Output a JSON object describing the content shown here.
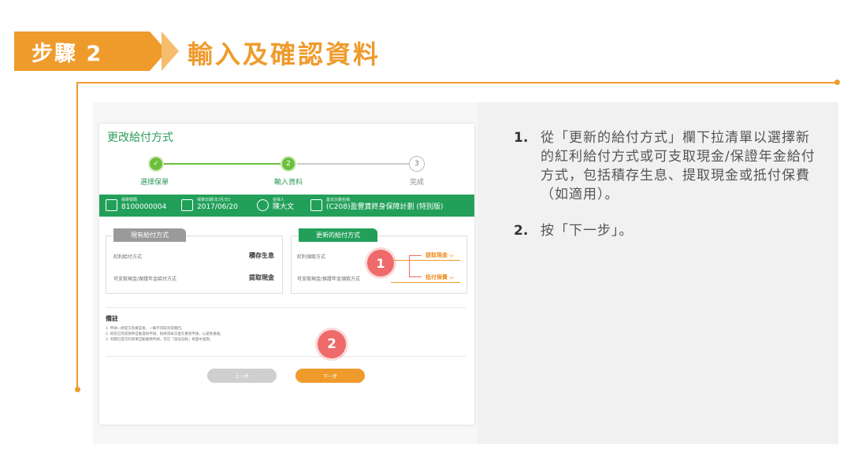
{
  "header": {
    "step_label": "步驟 2",
    "title": "輸入及確認資料"
  },
  "colors": {
    "accent": "#ef9b2c",
    "green": "#22a05a",
    "callout": "#ef6a6a"
  },
  "instructions": [
    {
      "num": "1.",
      "text": "從「更新的給付方式」欄下拉清單以選擇新的紅利給付方式或可支取現金/保證年金給付方式，包括積存生息、提取現金或抵付保費（如適用）。"
    },
    {
      "num": "2.",
      "text": "按「下一步」。"
    }
  ],
  "card": {
    "title": "更改給付方式",
    "steps": [
      {
        "num": "✓",
        "label": "選擇保單"
      },
      {
        "num": "2",
        "label": "輸入資料"
      },
      {
        "num": "3",
        "label": "完成"
      }
    ],
    "info_bar": [
      {
        "icon": "policy-icon",
        "small": "保單號碼",
        "value": "8100000004"
      },
      {
        "icon": "calendar-icon",
        "small": "保單日期(年/月/日)",
        "value": "2017/06/20"
      },
      {
        "icon": "person-icon",
        "small": "受保人",
        "value": "陳大文"
      },
      {
        "icon": "document-icon",
        "small": "基本計劃名稱",
        "value": "(C208)盈豐寶終身保障計劃 (特別版)"
      }
    ],
    "old_tab": "現有給付方式",
    "new_tab": "更新的給付方式",
    "old_rows": [
      {
        "label": "紅利給付方式",
        "value": "積存生息"
      },
      {
        "label": "可支取現金/保證年金給付方式",
        "value": "提取現金"
      }
    ],
    "new_rows": [
      {
        "label": "紅利領取方式",
        "value": "提取現金 ⌵"
      },
      {
        "label": "可支取現金/保證年金領取方式",
        "value": "抵付保費 ⌵"
      }
    ],
    "callout_1": "1",
    "callout_2": "2",
    "remark_title": "備註",
    "remarks": [
      "1. 申請一經提交及確認後，一概不得取消或撤回。",
      "2. 如您已完成保單自動貸款申請，則將須再次遞交重新申請，以避免重複。",
      "3. 有關已提交的保單自動服務申請，可在「過往記錄」頁面中查閱。"
    ],
    "prev_button": "上一步",
    "next_button": "下一步"
  }
}
